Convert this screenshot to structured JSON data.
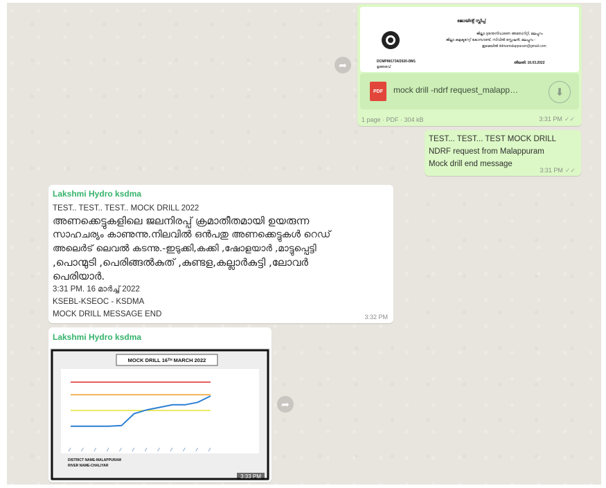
{
  "messages": {
    "doc": {
      "letterhead_title": "ജോയിൻ്റ് സ്ലിപ്പ്",
      "letterhead_line1": "ജില്ലാ ദുരന്തനിവാരണ അതോറിറ്റി, മലപ്പുറം",
      "letterhead_line2": "ജില്ലാ കളക്ടറേറ്റ് കോമ്പൗണ്ട്, സിവിൽ സ്റ്റേഷൻ, മലപ്പുറം -",
      "letterhead_line3": "ഇമെയിൽ ddmamalappuram@gmail.com",
      "ref_no": "DCMPM/1734/2020-DM1",
      "ref_label": "ഉത്തരവ്",
      "date_text": "തീയതി: 16.03.2022",
      "name": "mock drill -ndrf request_malapp…",
      "pdf_label": "PDF",
      "meta": "1 page · PDF · 304 kB",
      "time": "3:31 PM"
    },
    "text_out": {
      "line1": "TEST... TEST... TEST MOCK DRILL",
      "line2": "NDRF request from Malappuram",
      "line3": "Mock drill end message",
      "time": "3:31 PM"
    },
    "text_in": {
      "sender": "Lakshmi Hydro ksdma",
      "line1": "TEST.. TEST..  TEST.. MOCK DRILL 2022",
      "mal1": "അണക്കെട്ടുകളിലെ ജലനിരപ്പ് ക്രമാതീതമായി ഉയരുന്ന",
      "mal2": "സാഹചര്യം കാണുന്നു.നിലവിൽ ഒൻപതു അണക്കെട്ടുകൾ റെഡ്",
      "mal3": "അലെർട് ലെവൽ കടന്നു.-ഇടുക്കി,കക്കി ,ഷോളയാർ ,മാട്ടുപ്പെട്ടി",
      "mal4": ",പൊന്മുടി ,പെരിങ്ങൽകുത് ,കുണ്ടള,കല്ലാർകുട്ടി ,ലോവർ",
      "mal5": "പെരിയാർ.",
      "line2": "3:31 PM. 16 മാർച്ച് 2022",
      "line3": "KSEBL-KSEOC - KSDMA",
      "line4": "MOCK DRILL MESSAGE END",
      "time": "3:32 PM"
    },
    "image_in": {
      "sender": "Lakshmi Hydro ksdma",
      "chart_title": "MOCK DRILL 16ᵀᴴ MARCH 2022",
      "footer1": "DISTRICT NAME-MALAPPURAM",
      "footer2": "RIVER NAME-CHALIYAR",
      "time": "3:33 PM"
    }
  },
  "icons": {
    "forward": "forward-icon",
    "download": "download-icon",
    "pdf": "pdf-icon"
  },
  "colors": {
    "outgoing_bubble": "#dcf8c6",
    "incoming_bubble": "#ffffff",
    "sender_name": "#35b36b",
    "chat_bg": "#e8e4de"
  },
  "chart_data": {
    "type": "line",
    "title": "MOCK DRILL 16ᵀᴴ MARCH 2022",
    "series": [
      {
        "color": "#e03a3a",
        "values": [
          100,
          100,
          100,
          100,
          100,
          100,
          100,
          100,
          100,
          100,
          100,
          100
        ]
      },
      {
        "color": "#f0a030",
        "values": [
          80,
          80,
          80,
          80,
          80,
          80,
          80,
          80,
          80,
          80,
          80,
          80
        ]
      },
      {
        "color": "#e6e030",
        "values": [
          55,
          55,
          55,
          55,
          55,
          55,
          55,
          55,
          55,
          55,
          55,
          55
        ]
      },
      {
        "color": "#2a7fd4",
        "values": [
          30,
          30,
          30,
          30,
          31,
          50,
          56,
          60,
          64,
          64,
          68,
          78
        ]
      }
    ]
  }
}
